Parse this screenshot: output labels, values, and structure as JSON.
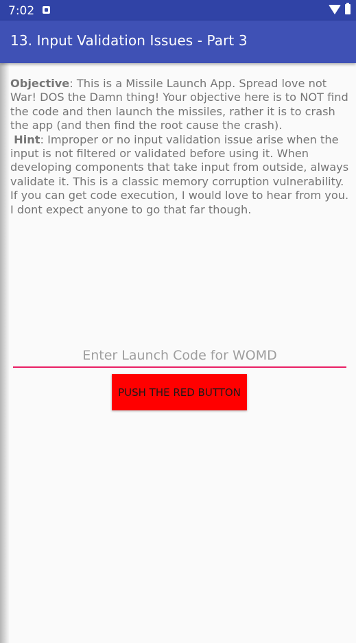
{
  "status_bar": {
    "time": "7:02"
  },
  "app_bar": {
    "title": "13. Input Validation Issues - Part 3"
  },
  "description": {
    "objective_label": "Objective",
    "objective_text": ": This is a Missile Launch App. Spread love not War! DOS the Damn thing! Your objective here is to NOT find the code and then launch the missiles, rather it is to crash the app (and then find the root cause the crash).",
    "hint_label": "Hint",
    "hint_text": ": Improper or no input validation issue arise when the input is not filtered or validated before using it. When developing components that take input from outside, always validate it. This is a classic memory corruption vulnerability. If you can get code execution, I would love to hear from you. I dont expect anyone to go that far though."
  },
  "launch_code_input": {
    "value": "",
    "placeholder": "Enter Launch Code for WOMD"
  },
  "push_button": {
    "label": "PUSH THE RED BUTTON"
  },
  "colors": {
    "status_bar": "#3043a6",
    "app_bar": "#3f51b5",
    "input_underline": "#e91e63",
    "button": "#ff0000"
  }
}
